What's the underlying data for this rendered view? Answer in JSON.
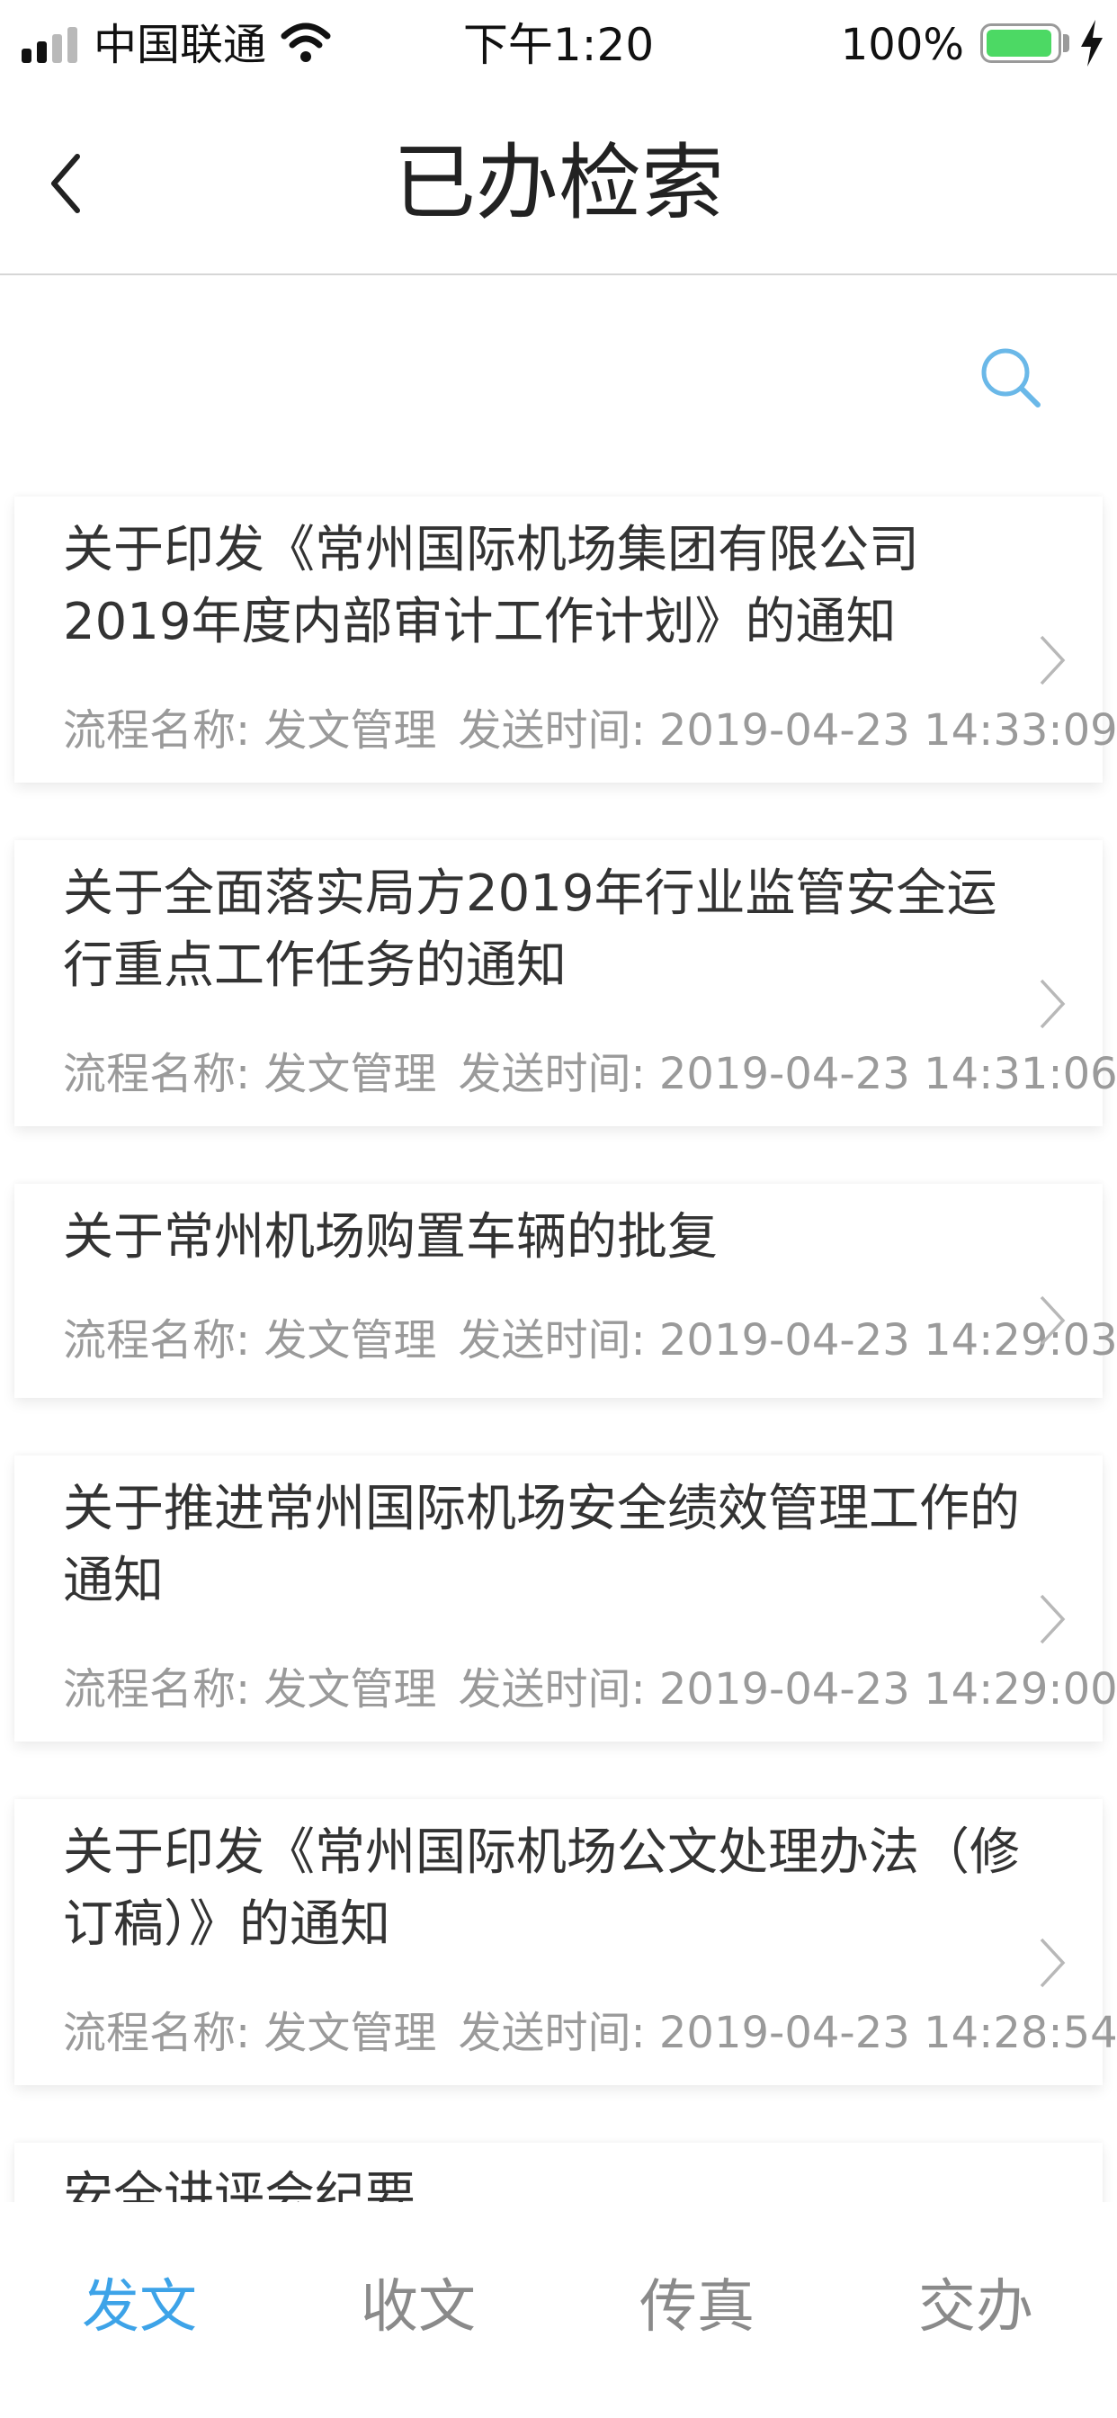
{
  "status_bar": {
    "carrier": "中国联通",
    "time": "下午1:20",
    "battery": "100%"
  },
  "nav": {
    "title": "已办检索"
  },
  "icons": {
    "back": "chevron-left-icon",
    "search": "search-icon",
    "row": "chevron-right-icon"
  },
  "colors": {
    "accent": "#3da3e8",
    "battery": "#4cd964",
    "meta_text": "#9a9a9a"
  },
  "list": {
    "items": [
      {
        "title": "关于印发《常州国际机场集团有限公司2019年度内部审计工作计划》的通知",
        "flow_label": "流程名称: 发文管理",
        "time_label": "发送时间: 2019-04-23 14:33:09"
      },
      {
        "title": "关于全面落实局方2019年行业监管安全运行重点工作任务的通知",
        "flow_label": "流程名称: 发文管理",
        "time_label": "发送时间: 2019-04-23 14:31:06"
      },
      {
        "title": "关于常州机场购置车辆的批复",
        "flow_label": "流程名称: 发文管理",
        "time_label": "发送时间: 2019-04-23 14:29:03"
      },
      {
        "title": "关于推进常州国际机场安全绩效管理工作的通知",
        "flow_label": "流程名称: 发文管理",
        "time_label": "发送时间: 2019-04-23 14:29:00"
      },
      {
        "title": "关于印发《常州国际机场公文处理办法（修订稿）》的通知",
        "flow_label": "流程名称: 发文管理",
        "time_label": "发送时间: 2019-04-23 14:28:54"
      },
      {
        "title": "安全讲评会纪要"
      }
    ]
  },
  "tabs": [
    {
      "label": "发文",
      "active": true
    },
    {
      "label": "收文",
      "active": false
    },
    {
      "label": "传真",
      "active": false
    },
    {
      "label": "交办",
      "active": false
    }
  ]
}
